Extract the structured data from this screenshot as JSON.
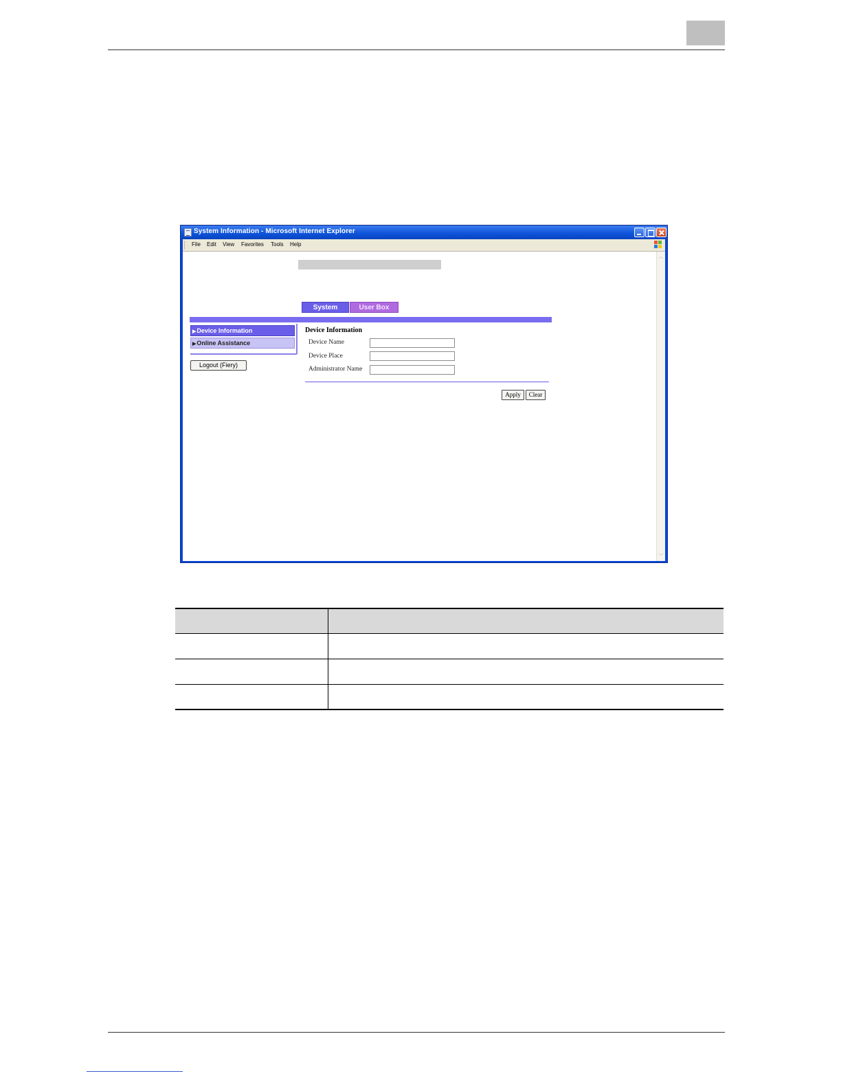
{
  "browser": {
    "title": "System Information - Microsoft Internet Explorer",
    "menu": [
      "File",
      "Edit",
      "View",
      "Favorites",
      "Tools",
      "Help"
    ],
    "window_buttons": [
      "minimize",
      "maximize",
      "close"
    ]
  },
  "web_page": {
    "tabs": [
      "System",
      "User Box"
    ],
    "sidebar": {
      "items": [
        "Device Information",
        "Online Assistance"
      ],
      "arrow": "▶",
      "logout_label": "Logout (Fiery)"
    },
    "form": {
      "title": "Device Information",
      "fields": [
        {
          "label": "Device Name",
          "value": ""
        },
        {
          "label": "Device Place",
          "value": ""
        },
        {
          "label": "Administrator Name",
          "value": ""
        }
      ],
      "apply_label": "Apply",
      "clear_label": "Clear"
    }
  },
  "colors": {
    "title_bar": "#0d52d8",
    "tab_active": "#6a5ee8",
    "tab_inactive": "#b06ae0",
    "nav_band": "#7a6cf0",
    "table_header": "#d9d9d9"
  },
  "table": {
    "rows": 3,
    "header": [
      "",
      ""
    ],
    "cells": [
      [
        "",
        ""
      ],
      [
        "",
        ""
      ],
      [
        "",
        ""
      ]
    ]
  }
}
